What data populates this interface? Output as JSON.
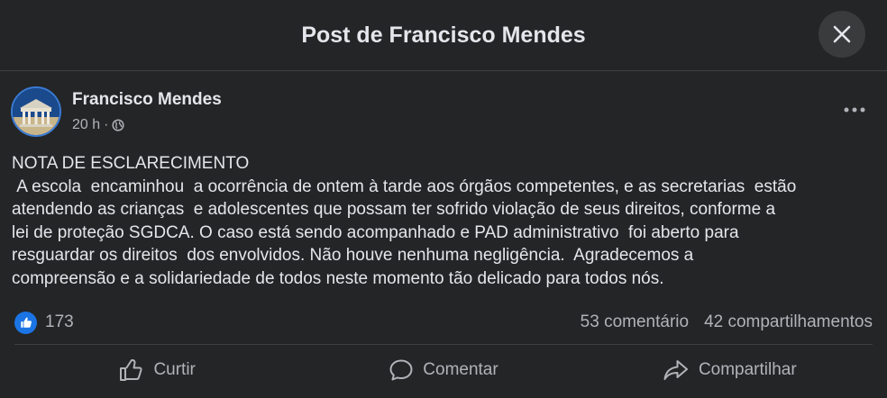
{
  "header": {
    "title": "Post de Francisco Mendes"
  },
  "author": {
    "name": "Francisco Mendes",
    "time": "20 h",
    "separator": "·"
  },
  "post": {
    "lines": [
      "NOTA DE ESCLARECIMENTO",
      " A escola  encaminhou  a ocorrência de ontem à tarde aos órgãos competentes, e as secretarias  estão",
      "atendendo as crianças  e adolescentes que possam ter sofrido violação de seus direitos, conforme a",
      "lei de proteção SGDCA. O caso está sendo acompanhado e PAD administrativo  foi aberto para",
      "resguardar os direitos  dos envolvidos. Não houve nenhuma negligência.  Agradecemos a",
      "compreensão e a solidariedade de todos neste momento tão delicado para todos nós."
    ]
  },
  "stats": {
    "likes": "173",
    "comments": "53 comentário",
    "shares": "42 compartilhamentos"
  },
  "actions": {
    "like": "Curtir",
    "comment": "Comentar",
    "share": "Compartilhar"
  },
  "colors": {
    "background": "#242526",
    "accent": "#1b74e4",
    "text": "#e4e6eb",
    "secondary_text": "#b0b3b8"
  },
  "icons": [
    "close-icon",
    "globe-icon",
    "more-options-icon",
    "like-reaction-icon",
    "thumbs-up-icon",
    "comment-icon",
    "share-icon"
  ]
}
